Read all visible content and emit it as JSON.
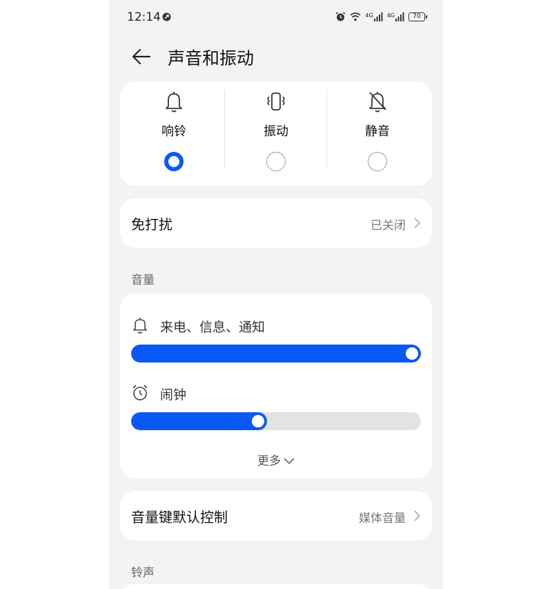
{
  "status_bar": {
    "time": "12:14",
    "net_1": "4G",
    "net_2": "4G",
    "battery": "70"
  },
  "header": {
    "title": "声音和振动"
  },
  "modes": [
    {
      "label": "响铃",
      "icon": "bell-icon",
      "selected": true
    },
    {
      "label": "振动",
      "icon": "vibrate-icon",
      "selected": false
    },
    {
      "label": "静音",
      "icon": "bell-off-icon",
      "selected": false
    }
  ],
  "dnd": {
    "label": "免打扰",
    "value": "已关闭"
  },
  "volume": {
    "section_title": "音量",
    "ringer": {
      "label": "来电、信息、通知",
      "level": 1.0,
      "icon": "bell-icon"
    },
    "alarm": {
      "label": "闹钟",
      "level": 0.47,
      "icon": "alarm-clock-icon"
    },
    "more_label": "更多"
  },
  "volume_key": {
    "label": "音量键默认控制",
    "value": "媒体音量"
  },
  "ringtone": {
    "section_title": "铃声"
  },
  "colors": {
    "accent": "#0a59f7",
    "background": "#f1f3f5"
  }
}
